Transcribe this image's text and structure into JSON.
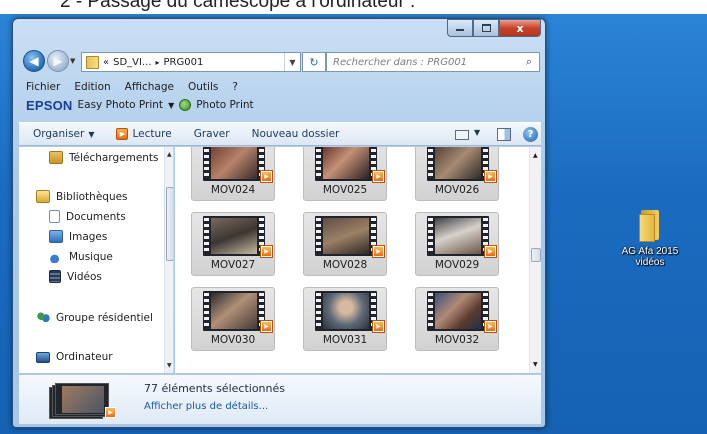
{
  "document": {
    "heading_fragment": "2 - Passage du caméscope à l'ordinateur :"
  },
  "window": {
    "caption_buttons": {
      "minimize": "—",
      "maximize": "□",
      "close": "x"
    },
    "address": {
      "chevron": "«",
      "path": [
        "SD_VI...",
        "PRG001"
      ],
      "separator": "▸"
    },
    "search": {
      "placeholder": "Rechercher dans : PRG001"
    },
    "menu": [
      "Fichier",
      "Edition",
      "Affichage",
      "Outils",
      "?"
    ],
    "epson_bar": {
      "logo": "EPSON",
      "easy_photo_print": "Easy Photo Print",
      "photo_print": "Photo Print"
    },
    "toolbar": {
      "organize": "Organiser",
      "play": "Lecture",
      "burn": "Graver",
      "new_folder": "Nouveau dossier"
    },
    "nav_pane": {
      "items": [
        {
          "label": "Téléchargements",
          "icon": "downloads-folder-icon"
        },
        {
          "label": "Bibliothèques",
          "icon": "libraries-icon"
        },
        {
          "label": "Documents",
          "icon": "documents-icon"
        },
        {
          "label": "Images",
          "icon": "pictures-icon"
        },
        {
          "label": "Musique",
          "icon": "music-icon"
        },
        {
          "label": "Vidéos",
          "icon": "videos-icon"
        },
        {
          "label": "Groupe résidentiel",
          "icon": "homegroup-icon"
        },
        {
          "label": "Ordinateur",
          "icon": "computer-icon"
        }
      ]
    },
    "files": [
      {
        "name": "MOV024"
      },
      {
        "name": "MOV025"
      },
      {
        "name": "MOV026"
      },
      {
        "name": "MOV027"
      },
      {
        "name": "MOV028"
      },
      {
        "name": "MOV029"
      },
      {
        "name": "MOV030"
      },
      {
        "name": "MOV031"
      },
      {
        "name": "MOV032"
      }
    ],
    "details": {
      "count_text": "77 éléments sélectionnés",
      "more_link": "Afficher plus de détails..."
    }
  },
  "desktop": {
    "icons": [
      {
        "label": "AG Afa 2015 vidéos",
        "icon": "folder-icon"
      }
    ]
  },
  "colors": {
    "desktop_blue": "#1a6bc0",
    "window_frame": "#a9c9ea",
    "close_red": "#c8432b",
    "selection_gray": "#d2d2d2",
    "link_blue": "#1c57a8"
  }
}
